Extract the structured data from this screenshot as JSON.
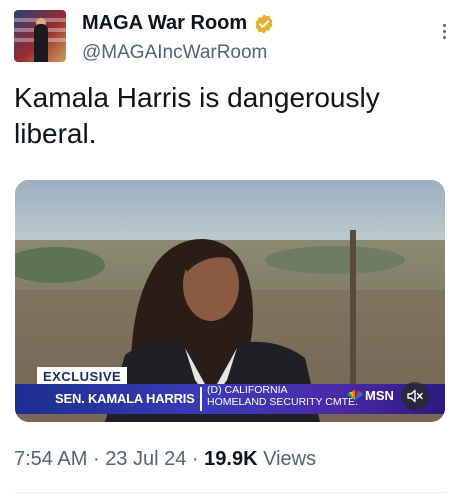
{
  "author": {
    "display_name": "MAGA War Room",
    "handle": "@MAGAIncWarRoom",
    "verified_badge_color": "#e8b02a"
  },
  "tweet": {
    "text": "Kamala Harris is dangerously liberal."
  },
  "video": {
    "exclusive_label": "EXCLUSIVE",
    "lower_third_name": "SEN. KAMALA HARRIS",
    "lower_third_party_line1": "(D) CALIFORNIA",
    "lower_third_party_line2": "HOMELAND SECURITY CMTE.",
    "network_logo_text": "MSN",
    "mute_icon": "speaker-muted-icon"
  },
  "meta": {
    "time": "7:54 AM",
    "separator": "·",
    "date": "23 Jul 24",
    "views_count": "19.9K",
    "views_label": "Views"
  },
  "colors": {
    "text_primary": "#0f1419",
    "text_secondary": "#536471",
    "lower_bar_blue": "#3b3bb8"
  }
}
